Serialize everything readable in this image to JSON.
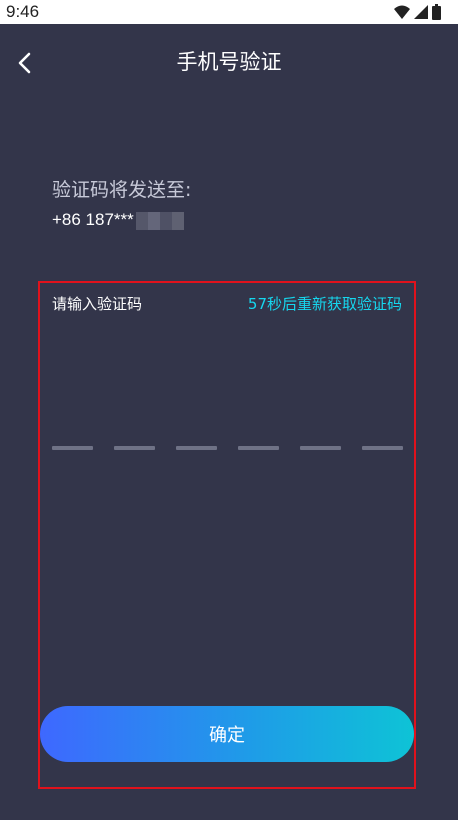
{
  "status_bar": {
    "time": "9:46",
    "icons": [
      "wifi-icon",
      "signal-icon",
      "battery-icon"
    ]
  },
  "header": {
    "title": "手机号验证",
    "back_icon": "chevron-left-icon"
  },
  "info": {
    "hint": "验证码将发送至:",
    "phone": "+86 187***"
  },
  "verification": {
    "label": "请输入验证码",
    "resend": "57秒后重新获取验证码",
    "slot_count": 6
  },
  "confirm_label": "确定",
  "colors": {
    "background": "#33354a",
    "accent": "#16d7ee",
    "button_gradient_start": "#3e68ff",
    "button_gradient_end": "#0ec3d6",
    "highlight": "#e0121c"
  }
}
